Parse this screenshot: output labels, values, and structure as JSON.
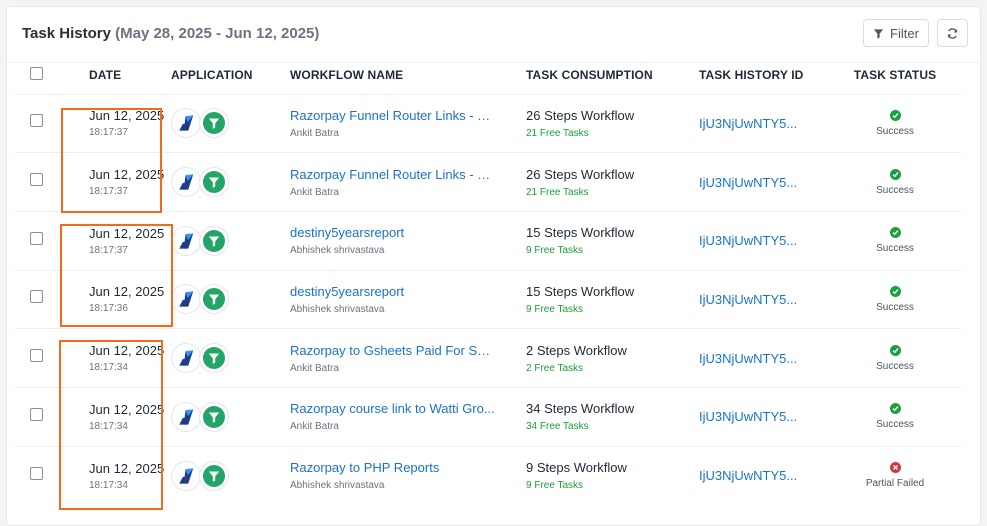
{
  "header": {
    "title": "Task History",
    "range": "(May 28, 2025 - Jun 12, 2025)",
    "filter_label": "Filter"
  },
  "columns": {
    "date": "DATE",
    "application": "APPLICATION",
    "workflow_name": "WORKFLOW NAME",
    "task_consumption": "TASK CONSUMPTION",
    "task_history_id": "TASK HISTORY ID",
    "task_status": "TASK STATUS"
  },
  "rows": [
    {
      "date": "Jun 12, 2025",
      "time": "18:17:37",
      "workflow": "Razorpay Funnel Router Links - Ge...",
      "owner": "Ankit Batra",
      "steps": "26 Steps Workflow",
      "free": "21 Free Tasks",
      "history_id": "IjU3NjUwNTY5...",
      "status": "Success"
    },
    {
      "date": "Jun 12, 2025",
      "time": "18:17:37",
      "workflow": "Razorpay Funnel Router Links - Ge...",
      "owner": "Ankit Batra",
      "steps": "26 Steps Workflow",
      "free": "21 Free Tasks",
      "history_id": "IjU3NjUwNTY5...",
      "status": "Success"
    },
    {
      "date": "Jun 12, 2025",
      "time": "18:17:37",
      "workflow": "destiny5yearsreport",
      "owner": "Abhishek shrivastava",
      "steps": "15 Steps Workflow",
      "free": "9 Free Tasks",
      "history_id": "IjU3NjUwNTY5...",
      "status": "Success"
    },
    {
      "date": "Jun 12, 2025",
      "time": "18:17:36",
      "workflow": "destiny5yearsreport",
      "owner": "Abhishek shrivastava",
      "steps": "15 Steps Workflow",
      "free": "9 Free Tasks",
      "history_id": "IjU3NjUwNTY5...",
      "status": "Success"
    },
    {
      "date": "Jun 12, 2025",
      "time": "18:17:34",
      "workflow": "Razorpay to Gsheets Paid For Sho...",
      "owner": "Ankit Batra",
      "steps": "2 Steps Workflow",
      "free": "2 Free Tasks",
      "history_id": "IjU3NjUwNTY5...",
      "status": "Success"
    },
    {
      "date": "Jun 12, 2025",
      "time": "18:17:34",
      "workflow": "Razorpay course link to Watti Gro...",
      "owner": "Ankit Batra",
      "steps": "34 Steps Workflow",
      "free": "34 Free Tasks",
      "history_id": "IjU3NjUwNTY5...",
      "status": "Success"
    },
    {
      "date": "Jun 12, 2025",
      "time": "18:17:34",
      "workflow": "Razorpay to PHP Reports",
      "owner": "Abhishek shrivastava",
      "steps": "9 Steps Workflow",
      "free": "9 Free Tasks",
      "history_id": "IjU3NjUwNTY5...",
      "status": "Partial Failed"
    }
  ],
  "colors": {
    "link": "#1a73c8",
    "success": "#1f9d44",
    "failed": "#d9363e",
    "free_tasks": "#1a9f3b",
    "highlight": "#f26a1b",
    "razorpay_blue": "#1f3c88",
    "filter_app_green": "#22a566"
  }
}
